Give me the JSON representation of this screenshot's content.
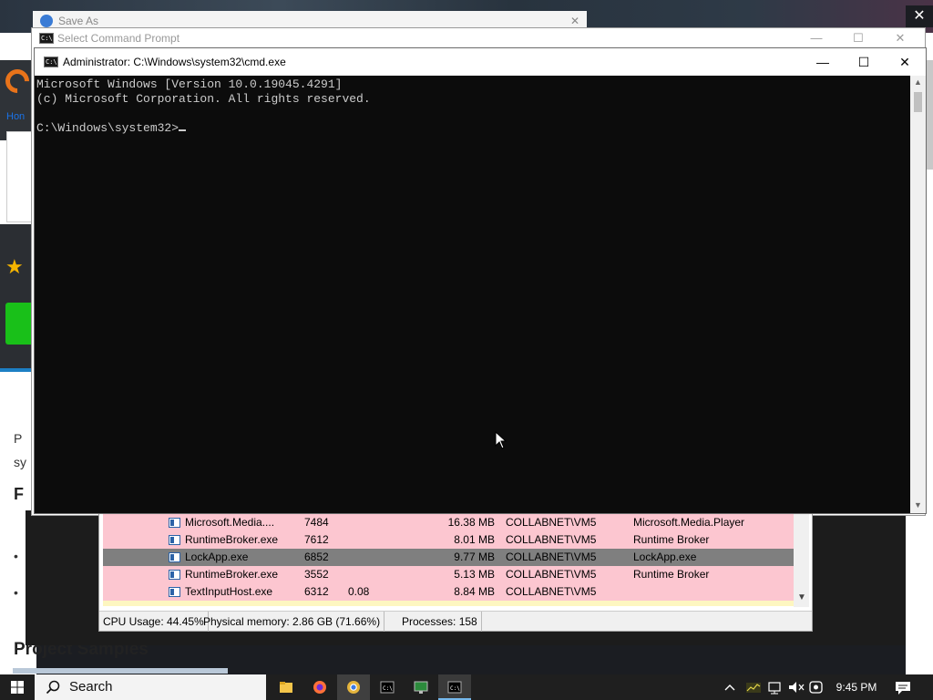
{
  "background_page": {
    "home_link": "Hon",
    "para_line_1": "P",
    "para_line_2": "sy",
    "heading_f": "F",
    "bullet_1": "•",
    "bullet_2": "•",
    "section_title": "Project Samples"
  },
  "save_as_window": {
    "title": "Save As"
  },
  "select_cmd_window": {
    "title": "Select Command Prompt"
  },
  "cmd_window": {
    "title": "Administrator: C:\\Windows\\system32\\cmd.exe",
    "lines": [
      "Microsoft Windows [Version 10.0.19045.4291]",
      "(c) Microsoft Corporation. All rights reserved.",
      "",
      "C:\\Windows\\system32>"
    ]
  },
  "process_list": {
    "rows": [
      {
        "name": "Microsoft.Media....",
        "pid": "7484",
        "cpu": "",
        "mem": "16.38 MB",
        "user": "COLLABNET\\VM5",
        "desc": "Microsoft.Media.Player",
        "style": "pink"
      },
      {
        "name": "RuntimeBroker.exe",
        "pid": "7612",
        "cpu": "",
        "mem": "8.01 MB",
        "user": "COLLABNET\\VM5",
        "desc": "Runtime Broker",
        "style": "pink"
      },
      {
        "name": "LockApp.exe",
        "pid": "6852",
        "cpu": "",
        "mem": "9.77 MB",
        "user": "COLLABNET\\VM5",
        "desc": "LockApp.exe",
        "style": "gray"
      },
      {
        "name": "RuntimeBroker.exe",
        "pid": "3552",
        "cpu": "",
        "mem": "5.13 MB",
        "user": "COLLABNET\\VM5",
        "desc": "Runtime Broker",
        "style": "pink"
      },
      {
        "name": "TextInputHost.exe",
        "pid": "6312",
        "cpu": "0.08",
        "mem": "8.84 MB",
        "user": "COLLABNET\\VM5",
        "desc": "",
        "style": "pink"
      }
    ],
    "status": {
      "cpu": "CPU Usage: 44.45%",
      "memory": "Physical memory: 2.86 GB (71.66%)",
      "processes": "Processes: 158"
    }
  },
  "taskbar": {
    "search_label": "Search",
    "apps": [
      "file-explorer",
      "firefox",
      "chrome",
      "cmd",
      "process-explorer",
      "cmd-admin"
    ],
    "clock": "9:45 PM"
  },
  "colors": {
    "console_bg": "#0c0c0c",
    "console_fg": "#cccccc",
    "row_pink": "#fcc6d0",
    "row_gray": "#7f7f7f",
    "taskbar_bg": "#1f1f1f"
  }
}
